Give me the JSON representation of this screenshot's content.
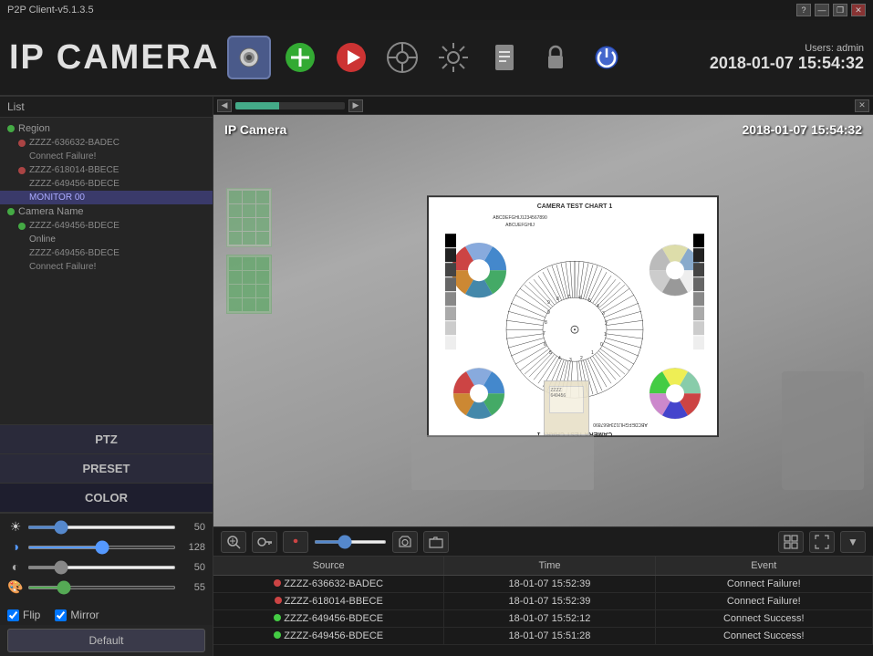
{
  "titlebar": {
    "title": "P2P Client-v5.1.3.5",
    "help": "?",
    "minimize": "—",
    "restore": "❐",
    "close": "✕"
  },
  "header": {
    "app_title": "IP CAMERA",
    "users_label": "Users: admin",
    "datetime": "2018-01-07  15:54:32",
    "icons": [
      {
        "name": "camera-icon",
        "symbol": "🎥",
        "active": true
      },
      {
        "name": "add-icon",
        "symbol": "➕",
        "active": false
      },
      {
        "name": "play-icon",
        "symbol": "▶",
        "active": false
      },
      {
        "name": "ptz-icon",
        "symbol": "🎯",
        "active": false
      },
      {
        "name": "settings-icon",
        "symbol": "⚙",
        "active": false
      },
      {
        "name": "file-icon",
        "symbol": "📋",
        "active": false
      },
      {
        "name": "lock-icon",
        "symbol": "🔒",
        "active": false
      },
      {
        "name": "power-icon",
        "symbol": "⏻",
        "active": false
      }
    ]
  },
  "sidebar": {
    "list_label": "List",
    "items": [
      {
        "label": "Region",
        "level": 0,
        "dot": "green",
        "selected": false
      },
      {
        "label": "ZZZZ-636632-BADEC",
        "level": 1,
        "dot": "red",
        "selected": false
      },
      {
        "label": "Connect Failure!",
        "level": 2,
        "dot": null,
        "selected": false
      },
      {
        "label": "ZZZZ-618014-BBECE",
        "level": 1,
        "dot": "red",
        "selected": false
      },
      {
        "label": "ZZZZ-649456-BDECE",
        "level": 2,
        "dot": null,
        "selected": false
      },
      {
        "label": "MONITOR 00",
        "level": 2,
        "dot": null,
        "selected": true
      },
      {
        "label": "Camera Name",
        "level": 0,
        "dot": "green",
        "selected": false
      },
      {
        "label": "ZZZZ-649456-BDECE",
        "level": 1,
        "dot": "green",
        "selected": false
      },
      {
        "label": "Online",
        "level": 2,
        "dot": null,
        "selected": false
      },
      {
        "label": "ZZZZ-649456-BDECE",
        "level": 2,
        "dot": null,
        "selected": false
      },
      {
        "label": "Connect Failure!",
        "level": 2,
        "dot": null,
        "selected": false
      }
    ],
    "ptz_label": "PTZ",
    "preset_label": "PRESET",
    "color_label": "COLOR"
  },
  "color_controls": {
    "brightness": {
      "icon": "☀",
      "value": 50,
      "min": 0,
      "max": 255
    },
    "contrast": {
      "icon": "◑",
      "value": 128,
      "min": 0,
      "max": 255
    },
    "saturation": {
      "icon": "◐",
      "value": 50,
      "min": 0,
      "max": 255
    },
    "hue": {
      "icon": "🎨",
      "value": 55,
      "min": 0,
      "max": 255
    },
    "flip_checked": true,
    "flip_label": "Flip",
    "mirror_checked": true,
    "mirror_label": "Mirror",
    "default_label": "Default"
  },
  "camera_feed": {
    "label": "IP Camera",
    "timestamp": "2018-01-07  15:54:32",
    "chart_title": "CAMERA TEST CHART 1",
    "letters": "ABCDEFGHIJ1234567890",
    "letters2": "ABCUEFGHI J"
  },
  "cam_controls": {
    "zoom_in": "🔍",
    "key_icon": "🔑",
    "record_icon": "⏺",
    "snap_icon": "📷",
    "folder_icon": "📁",
    "grid_icon": "⊞",
    "fullscreen_icon": "⛶",
    "more_icon": "▼"
  },
  "event_table": {
    "headers": [
      "Source",
      "Time",
      "Event"
    ],
    "rows": [
      {
        "dot": "red",
        "source": "ZZZZ-636632-BADEC",
        "time": "18-01-07 15:52:39",
        "event": "Connect Failure!"
      },
      {
        "dot": "red",
        "source": "ZZZZ-618014-BBECE",
        "time": "18-01-07 15:52:39",
        "event": "Connect Failure!"
      },
      {
        "dot": "green",
        "source": "ZZZZ-649456-BDECE",
        "time": "18-01-07 15:52:12",
        "event": "Connect Success!"
      },
      {
        "dot": "green",
        "source": "ZZZZ-649456-BDECE",
        "time": "18-01-07 15:51:28",
        "event": "Connect Success!"
      }
    ]
  }
}
